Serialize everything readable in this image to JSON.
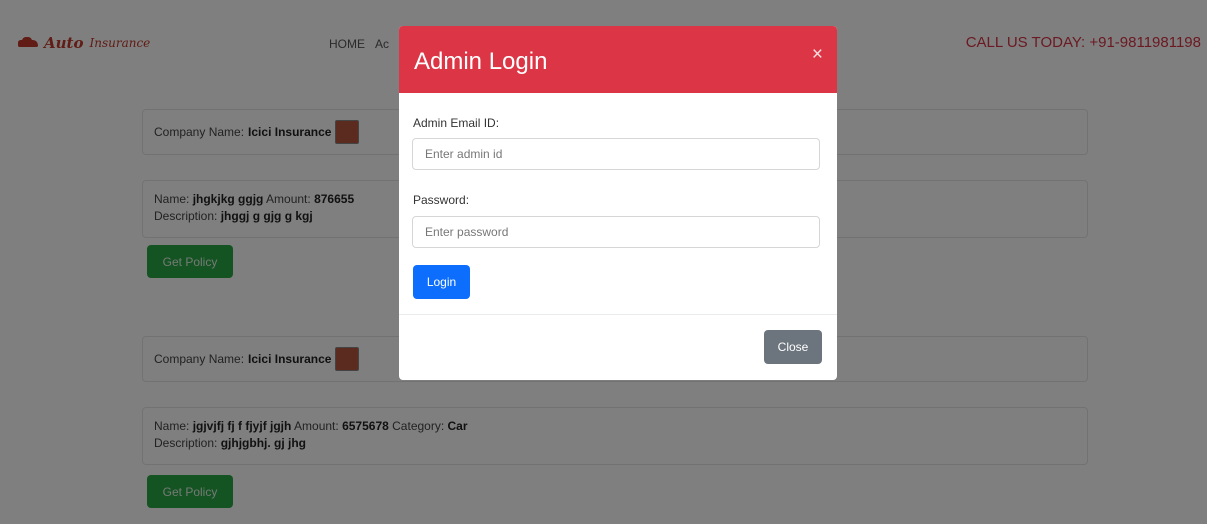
{
  "brand": {
    "auto": "Auto",
    "insurance": "Insurance"
  },
  "nav": {
    "home": "HOME",
    "item2": "Ac"
  },
  "header": {
    "call_us": "CALL US TODAY: +91-9811981198"
  },
  "policies": [
    {
      "company_label": "Company Name:",
      "company": "Icici Insurance",
      "name_label": "Name:",
      "name": "jhgkjkg ggjg",
      "amount_label": "Amount:",
      "amount": "876655",
      "category_label": "",
      "category": "",
      "description_label": "Description:",
      "description": "jhggj g gjg g kgj",
      "button": "Get Policy"
    },
    {
      "company_label": "Company Name:",
      "company": "Icici Insurance",
      "name_label": "Name:",
      "name": "jgjvjfj fj f fjyjf jgjh",
      "amount_label": "Amount:",
      "amount": "6575678",
      "category_label": "Category:",
      "category": "Car",
      "description_label": "Description:",
      "description": "gjhjgbhj. gj jhg",
      "button": "Get Policy"
    }
  ],
  "modal": {
    "title": "Admin Login",
    "close_x": "×",
    "email_label": "Admin Email ID:",
    "email_placeholder": "Enter admin id",
    "email_value": "",
    "password_label": "Password:",
    "password_placeholder": "Enter password",
    "password_value": "",
    "login_button": "Login",
    "close_button": "Close"
  },
  "colors": {
    "modal_header": "#dc3545",
    "login_button": "#0d6efd",
    "close_button": "#6c757d",
    "policy_button": "#28a745",
    "brand": "#c0392b"
  }
}
